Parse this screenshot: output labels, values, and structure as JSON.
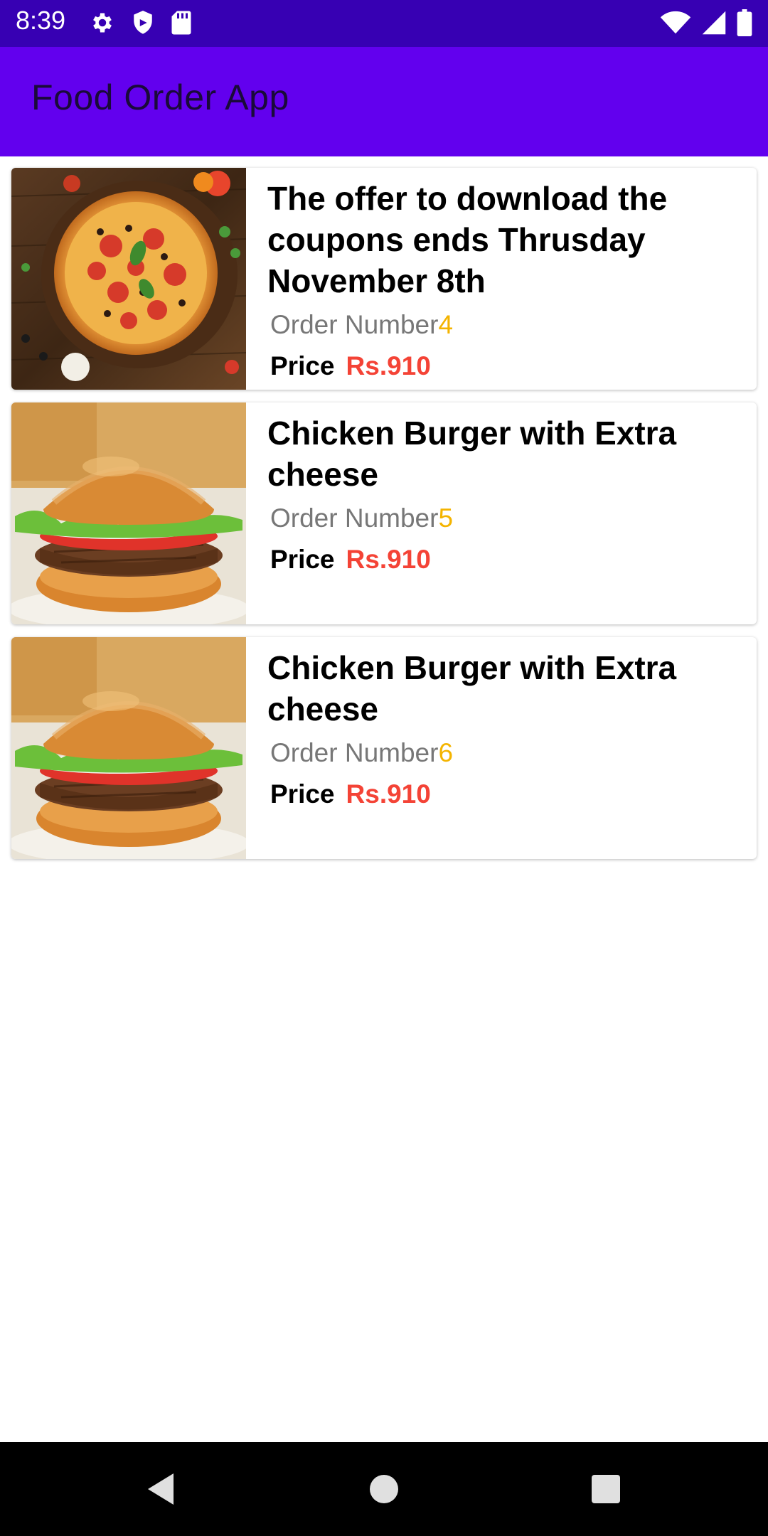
{
  "status_bar": {
    "time": "8:39",
    "icons_left": [
      "gear-icon",
      "shield-icon",
      "sd-card-icon"
    ],
    "icons_right": [
      "wifi-icon",
      "signal-icon",
      "battery-icon"
    ]
  },
  "app_bar": {
    "title": "Food Order App",
    "color": "#6200ee"
  },
  "status_color": "#3700b3",
  "orders": [
    {
      "title": "The offer to download the coupons ends Thrusday November 8th",
      "order_label": "Order Number",
      "order_number": "4",
      "price_label": "Price",
      "price": "Rs.910",
      "image": "pizza-image"
    },
    {
      "title": "Chicken Burger with Extra cheese",
      "order_label": "Order Number",
      "order_number": "5",
      "price_label": "Price",
      "price": "Rs.910",
      "image": "burger-image"
    },
    {
      "title": "Chicken Burger with Extra cheese",
      "order_label": "Order Number",
      "order_number": "6",
      "price_label": "Price",
      "price": "Rs.910",
      "image": "burger-image"
    }
  ],
  "nav_bar": {
    "buttons": [
      "back-icon",
      "home-icon",
      "recents-icon"
    ]
  },
  "colors": {
    "order_number": "#f4b400",
    "price": "#f44336"
  }
}
